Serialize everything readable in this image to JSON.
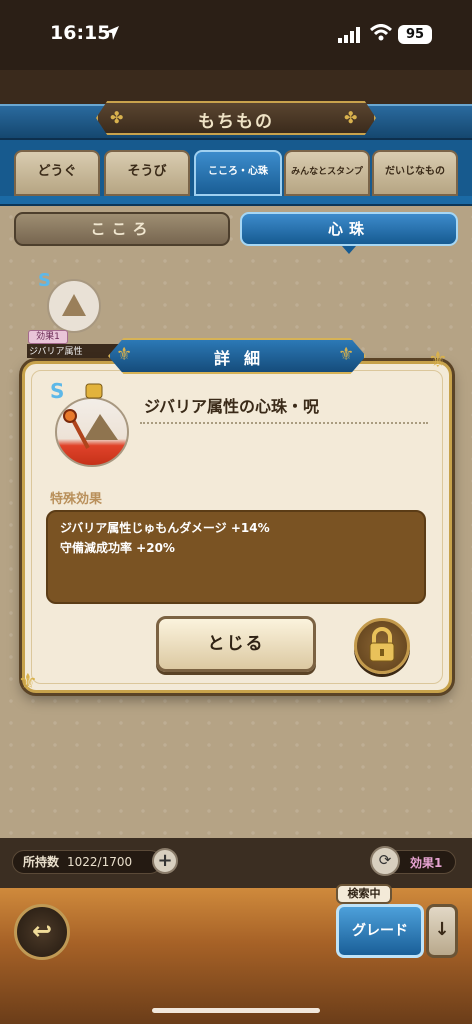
{
  "status": {
    "time": "16:15",
    "battery": "95"
  },
  "header": {
    "title": "もちもの"
  },
  "tabs": [
    {
      "label": "どうぐ",
      "active": false
    },
    {
      "label": "そうび",
      "active": false
    },
    {
      "label": "こころ・心珠",
      "active": true
    },
    {
      "label": "みんなとスタンプ",
      "active": false
    },
    {
      "label": "だいじなもの",
      "active": false
    }
  ],
  "subtabs": [
    {
      "label": "こころ",
      "active": false
    },
    {
      "label": "心珠",
      "active": true
    }
  ],
  "background_item": {
    "badge": "効果1",
    "name": "ジバリア属性"
  },
  "dialog": {
    "title": "詳細",
    "item_name": "ジバリア属性の心珠・呪",
    "effect_label": "特殊効果",
    "effects": [
      "ジバリア属性じゅもんダメージ +14%",
      "守備減成功率 +20%"
    ],
    "close_label": "とじる"
  },
  "inventory": {
    "label": "所持数",
    "count": "1022/1700"
  },
  "filter": {
    "effect_label": "効果1",
    "search_badge": "検索中",
    "grade_label": "グレード"
  },
  "colors": {
    "accent_blue": "#1a5f98",
    "gold": "#c7a24b",
    "effect_pink": "#e6a3d1"
  },
  "icons": [
    "location-arrow-icon",
    "signal-icon",
    "wifi-icon",
    "battery-icon",
    "lock-icon",
    "cycle-icon",
    "back-arrow-icon",
    "down-arrow-icon",
    "plus-icon"
  ]
}
